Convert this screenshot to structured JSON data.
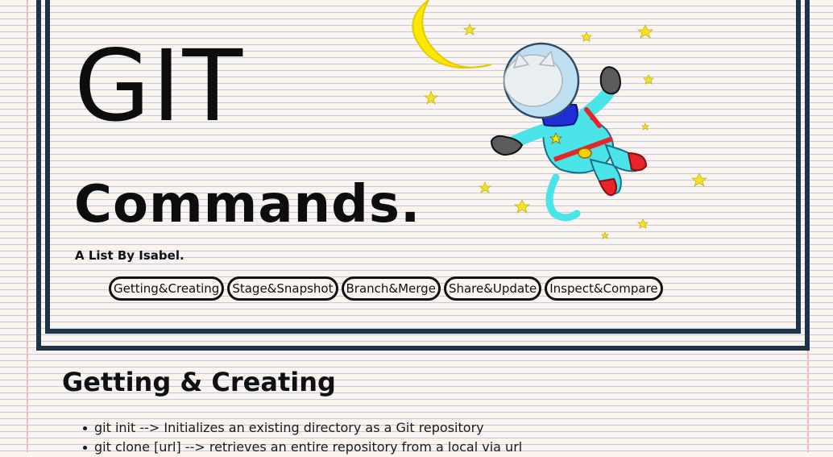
{
  "header": {
    "title_main": "GIT",
    "title_sub": "Commands.",
    "byline": "A List By Isabel."
  },
  "nav": {
    "items": [
      {
        "label": "Getting&Creating"
      },
      {
        "label": "Stage&Snapshot"
      },
      {
        "label": "Branch&Merge"
      },
      {
        "label": "Share&Update"
      },
      {
        "label": "Inspect&Compare"
      }
    ]
  },
  "illustration": {
    "icon": "astronaut-octocat-icon",
    "moon_color": "#fde800",
    "suit_color": "#49e3e8",
    "accent_color": "#e8242b"
  },
  "section": {
    "title": "Getting & Creating",
    "commands": [
      "git init --> Initializes an existing directory as a Git repository",
      "git clone [url] --> retrieves an entire repository from a local via url"
    ]
  },
  "colors": {
    "frame": "#1e3248",
    "paper": "#fbf4ee",
    "rule_line": "#b9cce8",
    "margin_line": "#f2b8c4"
  }
}
